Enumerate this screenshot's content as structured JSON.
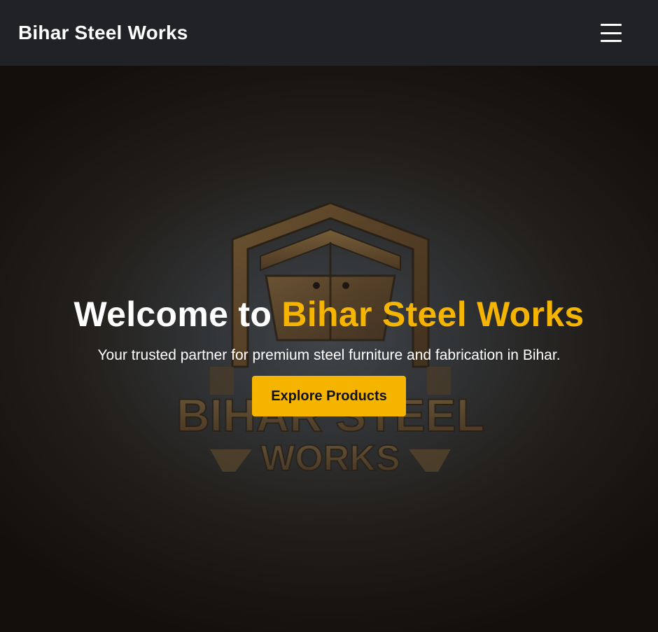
{
  "navbar": {
    "brand": "Bihar Steel Works",
    "menu_icon": "hamburger-menu-icon"
  },
  "hero": {
    "title_prefix": "Welcome to ",
    "title_accent": "Bihar Steel Works",
    "subtitle": "Your trusted partner for premium steel furniture and fabrication in Bihar.",
    "cta_label": "Explore Products",
    "background_logo": {
      "line1": "BIHAR STEEL",
      "line2": "WORKS"
    }
  },
  "colors": {
    "nav_bg": "#202226",
    "accent": "#f5b400",
    "text": "#ffffff"
  }
}
